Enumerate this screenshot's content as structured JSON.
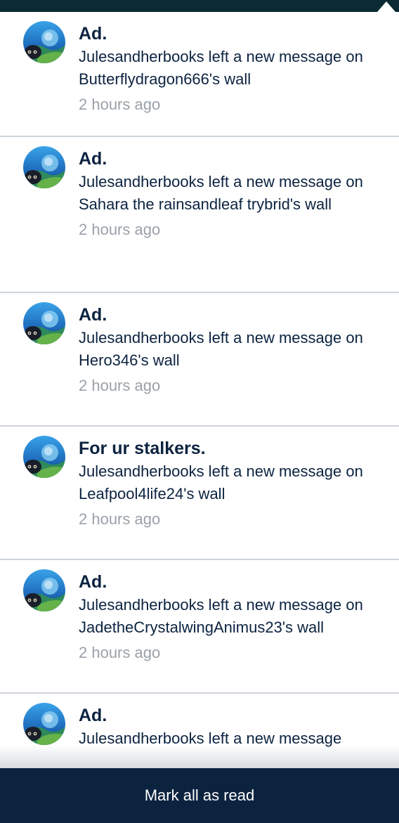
{
  "notifications": [
    {
      "title": "Ad.",
      "message": "Julesandherbooks left a new message on Butterflydragon666's wall",
      "time": "2 hours ago"
    },
    {
      "title": "Ad.",
      "message": "Julesandherbooks left a new message on Sahara the rainsandleaf trybrid's wall",
      "time": "2 hours ago"
    },
    {
      "title": "Ad.",
      "message": "Julesandherbooks left a new message on Hero346's wall",
      "time": "2 hours ago"
    },
    {
      "title": "For ur stalkers.",
      "message": "Julesandherbooks left a new message on Leafpool4life24's wall",
      "time": "2 hours ago"
    },
    {
      "title": "Ad.",
      "message": "Julesandherbooks left a new message on JadetheCrystalwingAnimus23's wall",
      "time": "2 hours ago"
    },
    {
      "title": "Ad.",
      "message": "Julesandherbooks left a new message",
      "time": ""
    }
  ],
  "footer": {
    "mark_all_label": "Mark all as read"
  },
  "colors": {
    "navy": "#0c2340",
    "topbar": "#0b2a33",
    "divider": "#cdd3da",
    "muted": "#9aa1a8"
  },
  "icons": {
    "avatar": "user-avatar-icon"
  }
}
